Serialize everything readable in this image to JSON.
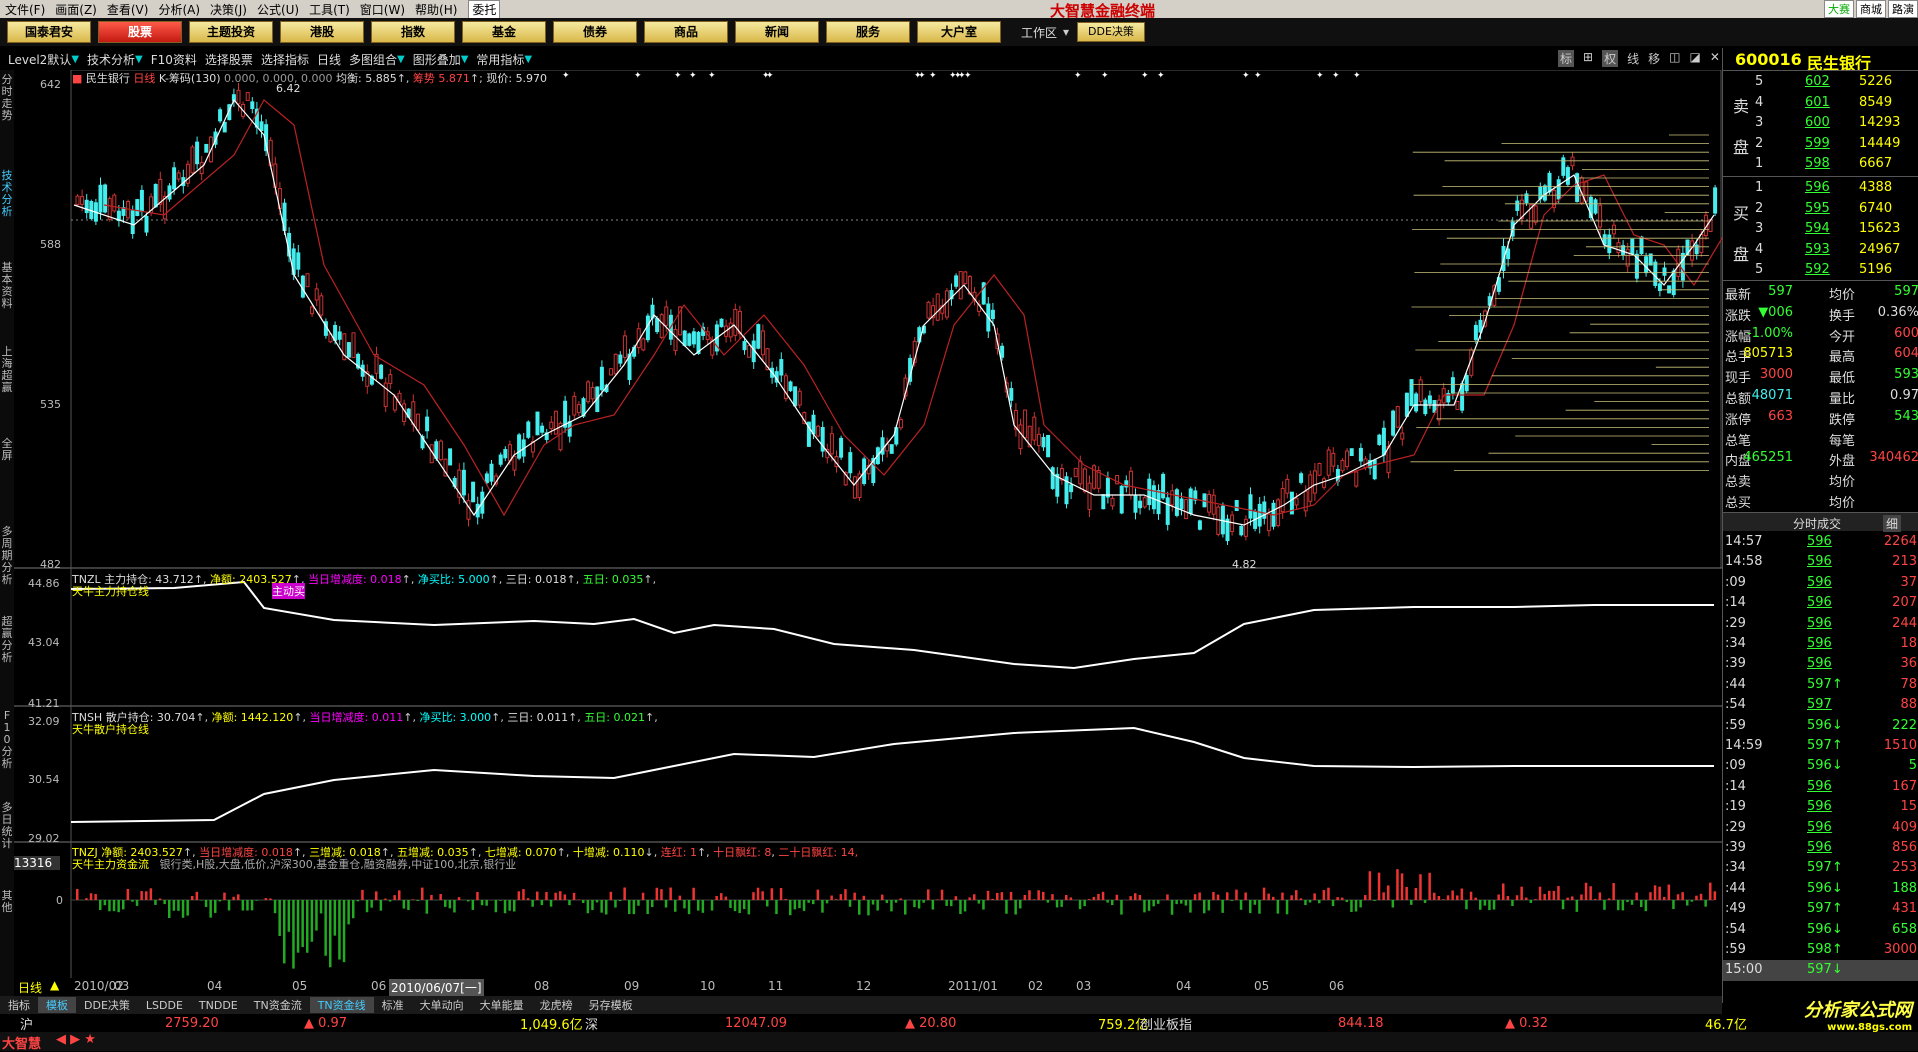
{
  "menu": {
    "items": [
      "文件(F)",
      "画面(Z)",
      "查看(V)",
      "分析(A)",
      "决策(J)",
      "公式(U)",
      "工具(T)",
      "窗口(W)",
      "帮助(H)"
    ],
    "xtuo": "委托"
  },
  "app_title": "大智慧金融终端",
  "top_right": [
    "大赛",
    "商城",
    "路演"
  ],
  "nav": {
    "items": [
      "国泰君安",
      "股票",
      "主题投资",
      "港股",
      "指数",
      "基金",
      "债券",
      "商品",
      "新闻",
      "服务",
      "大户室"
    ],
    "selected": 1,
    "workarea": "工作区",
    "dde": "DDE决策"
  },
  "toolbar": {
    "items": [
      "Level2默认",
      "技术分析",
      "F10资料",
      "选择股票",
      "选择指标",
      "日线",
      "多图组合",
      "图形叠加",
      "常用指标"
    ],
    "icons": [
      "标",
      "⊞",
      "权",
      "线",
      "移",
      "◫",
      "◪",
      "✕"
    ]
  },
  "left_tabs": [
    "分时走势",
    "技术分析",
    "基本资料",
    "上海超赢",
    "全屏",
    "多周期分析",
    "超赢分析",
    "F10分析",
    "多日统计",
    "其他"
  ],
  "left_tab_active": 1,
  "main_chart": {
    "label_stock": "民生银行",
    "label_period": "日线",
    "label_formula": "K-筹码(130)",
    "label_params": "0.000, 0.000, 0.000",
    "junheng_label": "均衡:",
    "junheng": "5.885",
    "yali_label": "筹势",
    "yali": "5.871",
    "xianjia_label": "现价:",
    "xianjia": "5.970",
    "y_ticks": [
      "642",
      "588",
      "535",
      "482"
    ],
    "high_label": "6.42",
    "low_label": "4.82"
  },
  "panel_tnzl": {
    "line1": [
      "TNZL 主力持仓: 43.712",
      "净额: 2403.527",
      "当日增减度: 0.018",
      "净买比: 5.000",
      "三日: 0.018",
      "五日: 0.035"
    ],
    "line2": "天牛主力持仓线",
    "marker": "主动买",
    "y_ticks": [
      "44.86",
      "43.04",
      "41.21"
    ]
  },
  "panel_tnsh": {
    "line1": [
      "TNSH 散户持仓: 30.704",
      "净额: 1442.120",
      "当日增减度: 0.011",
      "净买比: 3.000",
      "三日: 0.011",
      "五日: 0.021"
    ],
    "line2": "天牛散户持仓线",
    "y_ticks": [
      "32.09",
      "30.54",
      "29.02"
    ]
  },
  "panel_tnzj": {
    "line1": [
      "TNZJ 净额: 2403.527",
      "当日增减度: 0.018",
      "三增减: 0.018",
      "五增减: 0.035",
      "七增减: 0.070",
      "十增减: 0.110",
      "连红: 1",
      "十日飘红: 8",
      "二十日飘红: 14,"
    ],
    "line2": "天牛主力资金流",
    "line2b": "银行类,H股,大盘,低价,沪深300,基金重仓,融资融券,中证100,北京,银行业",
    "box": "13316",
    "zero": "0"
  },
  "date_axis": {
    "period": "日线",
    "labels": [
      "2010/02",
      "03",
      "04",
      "05",
      "06",
      "2010/06/07[一]",
      "08",
      "09",
      "10",
      "11",
      "12",
      "2011/01",
      "02",
      "03",
      "04",
      "05",
      "06"
    ]
  },
  "bottom_tabs": [
    "指标",
    "模板",
    "DDE决策",
    "LSDDE",
    "TNDDE",
    "TN资金流",
    "TN资金线",
    "标准",
    "大单动向",
    "大单能量",
    "龙虎榜",
    "另存模板"
  ],
  "bottom_tab_active": 6,
  "status": {
    "sh_label": "沪",
    "sh_index": "2759.20",
    "sh_chg": "▲ 0.97",
    "sh_amt": "1,049.6亿",
    "sz_label": "深",
    "sz_index": "12047.09",
    "sz_chg": "▲ 20.80",
    "sz_amt": "759.2亿",
    "cyb_label": "创业板指",
    "cyb_index": "844.18",
    "cyb_chg": "▲ 0.32",
    "cyb_amt": "46.7亿"
  },
  "brand": "大智慧",
  "right_panel": {
    "code": "600016",
    "name": "民生银行",
    "sell_label": [
      "卖",
      "盘"
    ],
    "buy_label": [
      "买",
      "盘"
    ],
    "sells": [
      {
        "n": "5",
        "p": "602",
        "v": "5226"
      },
      {
        "n": "4",
        "p": "601",
        "v": "8549"
      },
      {
        "n": "3",
        "p": "600",
        "v": "14293"
      },
      {
        "n": "2",
        "p": "599",
        "v": "14449"
      },
      {
        "n": "1",
        "p": "598",
        "v": "6667"
      }
    ],
    "buys": [
      {
        "n": "1",
        "p": "596",
        "v": "4388"
      },
      {
        "n": "2",
        "p": "595",
        "v": "6740"
      },
      {
        "n": "3",
        "p": "594",
        "v": "15623"
      },
      {
        "n": "4",
        "p": "593",
        "v": "24967"
      },
      {
        "n": "5",
        "p": "592",
        "v": "5196"
      }
    ],
    "stats": [
      [
        "最新",
        "597",
        "均价",
        "597"
      ],
      [
        "涨跌",
        "▼006",
        "换手",
        "0.36%"
      ],
      [
        "涨幅",
        "-1.00%",
        "今开",
        "600"
      ],
      [
        "总手",
        "805713",
        "最高",
        "604"
      ],
      [
        "现手",
        "3000",
        "最低",
        "593"
      ],
      [
        "总额",
        "48071",
        "量比",
        "0.97"
      ],
      [
        "涨停",
        "663",
        "跌停",
        "543"
      ],
      [
        "总笔",
        "",
        "每笔",
        ""
      ],
      [
        "内盘",
        "465251",
        "外盘",
        "340462"
      ],
      [
        "总卖",
        "",
        "均价",
        ""
      ],
      [
        "总买",
        "",
        "均价",
        ""
      ]
    ],
    "ticks_header": "分时成交",
    "ticks_btn": "细",
    "ticks": [
      [
        "14:57",
        "596",
        "2264"
      ],
      [
        "14:58",
        "596",
        "213"
      ],
      [
        ":09",
        "596",
        "37"
      ],
      [
        ":14",
        "596",
        "207"
      ],
      [
        ":29",
        "596",
        "244"
      ],
      [
        ":34",
        "596",
        "18"
      ],
      [
        ":39",
        "596",
        "36"
      ],
      [
        ":44",
        "597↑",
        "78"
      ],
      [
        ":54",
        "597",
        "88"
      ],
      [
        ":59",
        "596↓",
        "222"
      ],
      [
        "14:59",
        "597↑",
        "1510"
      ],
      [
        ":09",
        "596↓",
        "5"
      ],
      [
        ":14",
        "596",
        "167"
      ],
      [
        ":19",
        "596",
        "15"
      ],
      [
        ":29",
        "596",
        "409"
      ],
      [
        ":39",
        "596",
        "856"
      ],
      [
        ":34",
        "597↑",
        "253"
      ],
      [
        ":44",
        "596↓",
        "188"
      ],
      [
        ":49",
        "597↑",
        "431"
      ],
      [
        ":54",
        "596↓",
        "658"
      ],
      [
        ":59",
        "598↑",
        "3000"
      ],
      [
        "15:00",
        "597↓",
        ""
      ]
    ]
  },
  "site_logo": "分析家公式网",
  "site_url": "www.88gs.com"
}
